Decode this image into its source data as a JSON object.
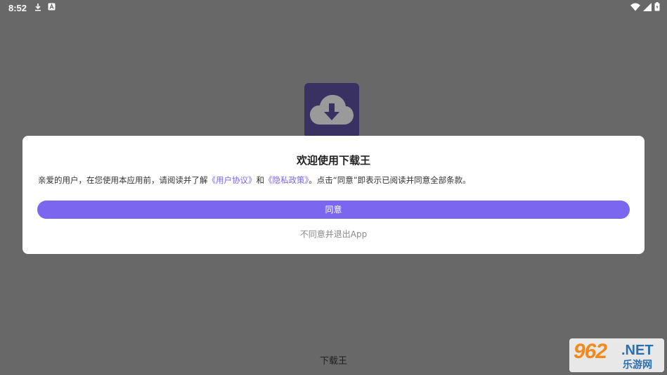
{
  "status_bar": {
    "time": "8:52",
    "left_icons": [
      "download-icon",
      "a-notification-icon"
    ],
    "right_icons": [
      "wifi-icon",
      "signal-icon",
      "battery-icon"
    ]
  },
  "app_logo": {
    "icon": "cloud-download-icon",
    "bg_color": "#3a3163"
  },
  "dialog": {
    "title": "欢迎使用下载王",
    "body_prefix": "亲爱的用户，在您使用本应用前，请阅读并了解",
    "user_agreement_link": "《用户协议》",
    "body_and": "和",
    "privacy_policy_link": "《隐私政策》",
    "body_suffix": "。点击“同意”即表示已阅读并同意全部条款。",
    "agree_label": "同意",
    "disagree_label": "不同意并退出App",
    "accent_color": "#7a66ef"
  },
  "bottom": {
    "app_name": "下载王"
  },
  "watermark": {
    "number": "962",
    "net": ".NET",
    "subtitle": "乐游网"
  }
}
